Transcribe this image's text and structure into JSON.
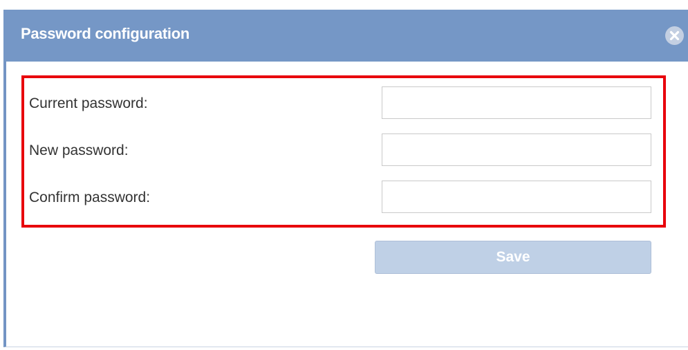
{
  "dialog": {
    "title": "Password configuration",
    "close_icon": "close-circle-icon"
  },
  "form": {
    "fields": [
      {
        "label": "Current password:",
        "value": ""
      },
      {
        "label": "New password:",
        "value": ""
      },
      {
        "label": "Confirm password:",
        "value": ""
      }
    ],
    "save_label": "Save"
  },
  "colors": {
    "titlebar": "#7597c6",
    "highlight": "#e8000b",
    "save_button": "#bfd0e6"
  }
}
